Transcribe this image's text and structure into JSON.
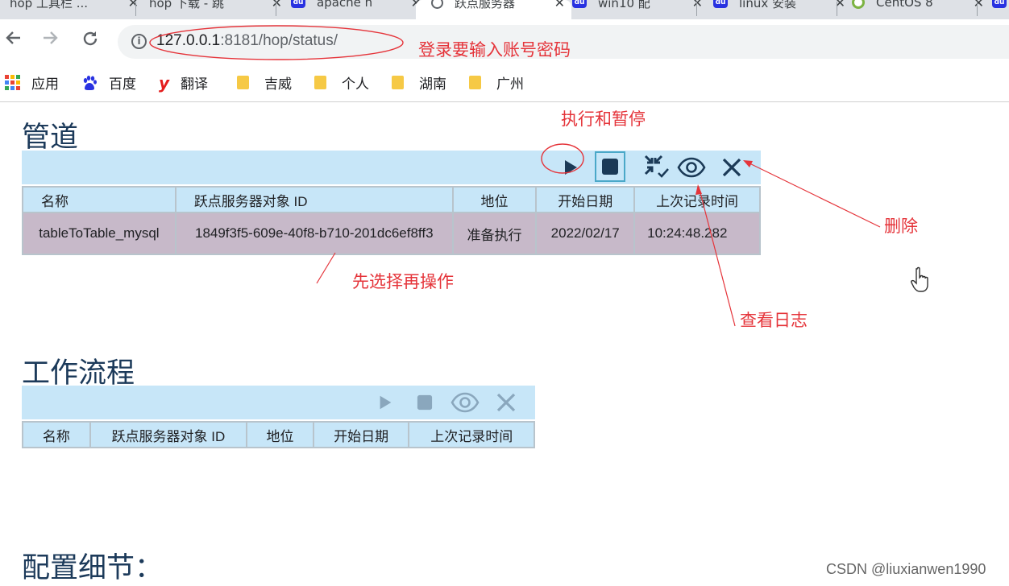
{
  "tabs": [
    {
      "icon": "",
      "title": "hop 工具栏 ..."
    },
    {
      "icon": "",
      "title": "hop 下载 - 跳"
    },
    {
      "icon": "du",
      "title": "apache h"
    },
    {
      "icon": "globe",
      "title": "跃点服务器"
    },
    {
      "icon": "du",
      "title": "win10 配"
    },
    {
      "icon": "du",
      "title": "linux 安装"
    },
    {
      "icon": "green",
      "title": "CentOS 8"
    },
    {
      "icon": "du",
      "title": ""
    }
  ],
  "address": {
    "host": "127.0.0.1",
    "rest": ":8181/hop/status/"
  },
  "bookmarks": [
    {
      "type": "apps",
      "label": "应用"
    },
    {
      "type": "baidu",
      "label": "百度"
    },
    {
      "type": "youdao",
      "label": "翻译"
    },
    {
      "type": "folder",
      "label": "吉威"
    },
    {
      "type": "folder",
      "label": "个人"
    },
    {
      "type": "folder",
      "label": "湖南"
    },
    {
      "type": "folder",
      "label": "广州"
    }
  ],
  "pipelines": {
    "title": "管道",
    "columns": [
      "名称",
      "跃点服务器对象 ID",
      "地位",
      "开始日期",
      "上次记录时间"
    ],
    "rows": [
      [
        "tableToTable_mysql",
        "1849f3f5-609e-40f8-b710-201dc6ef8ff3",
        "准备执行",
        "2022/02/17",
        "10:24:48.282"
      ]
    ]
  },
  "workflows": {
    "title": "工作流程",
    "columns": [
      "名称",
      "跃点服务器对象 ID",
      "地位",
      "开始日期",
      "上次记录时间"
    ]
  },
  "config": {
    "title": "配置细节："
  },
  "annotations": {
    "login": "登录要输入账号密码",
    "run_pause": "执行和暂停",
    "delete": "删除",
    "select_first": "先选择再操作",
    "view_log": "查看日志"
  },
  "watermark": "CSDN @liuxianwen1990",
  "colors": {
    "annotation": "#e5343a",
    "bar": "#c7e6f8",
    "row": "#c7b9c9",
    "title": "#1c3a5a",
    "icon_dark": "#1b3a57",
    "icon_dim": "#8aa7bd"
  }
}
